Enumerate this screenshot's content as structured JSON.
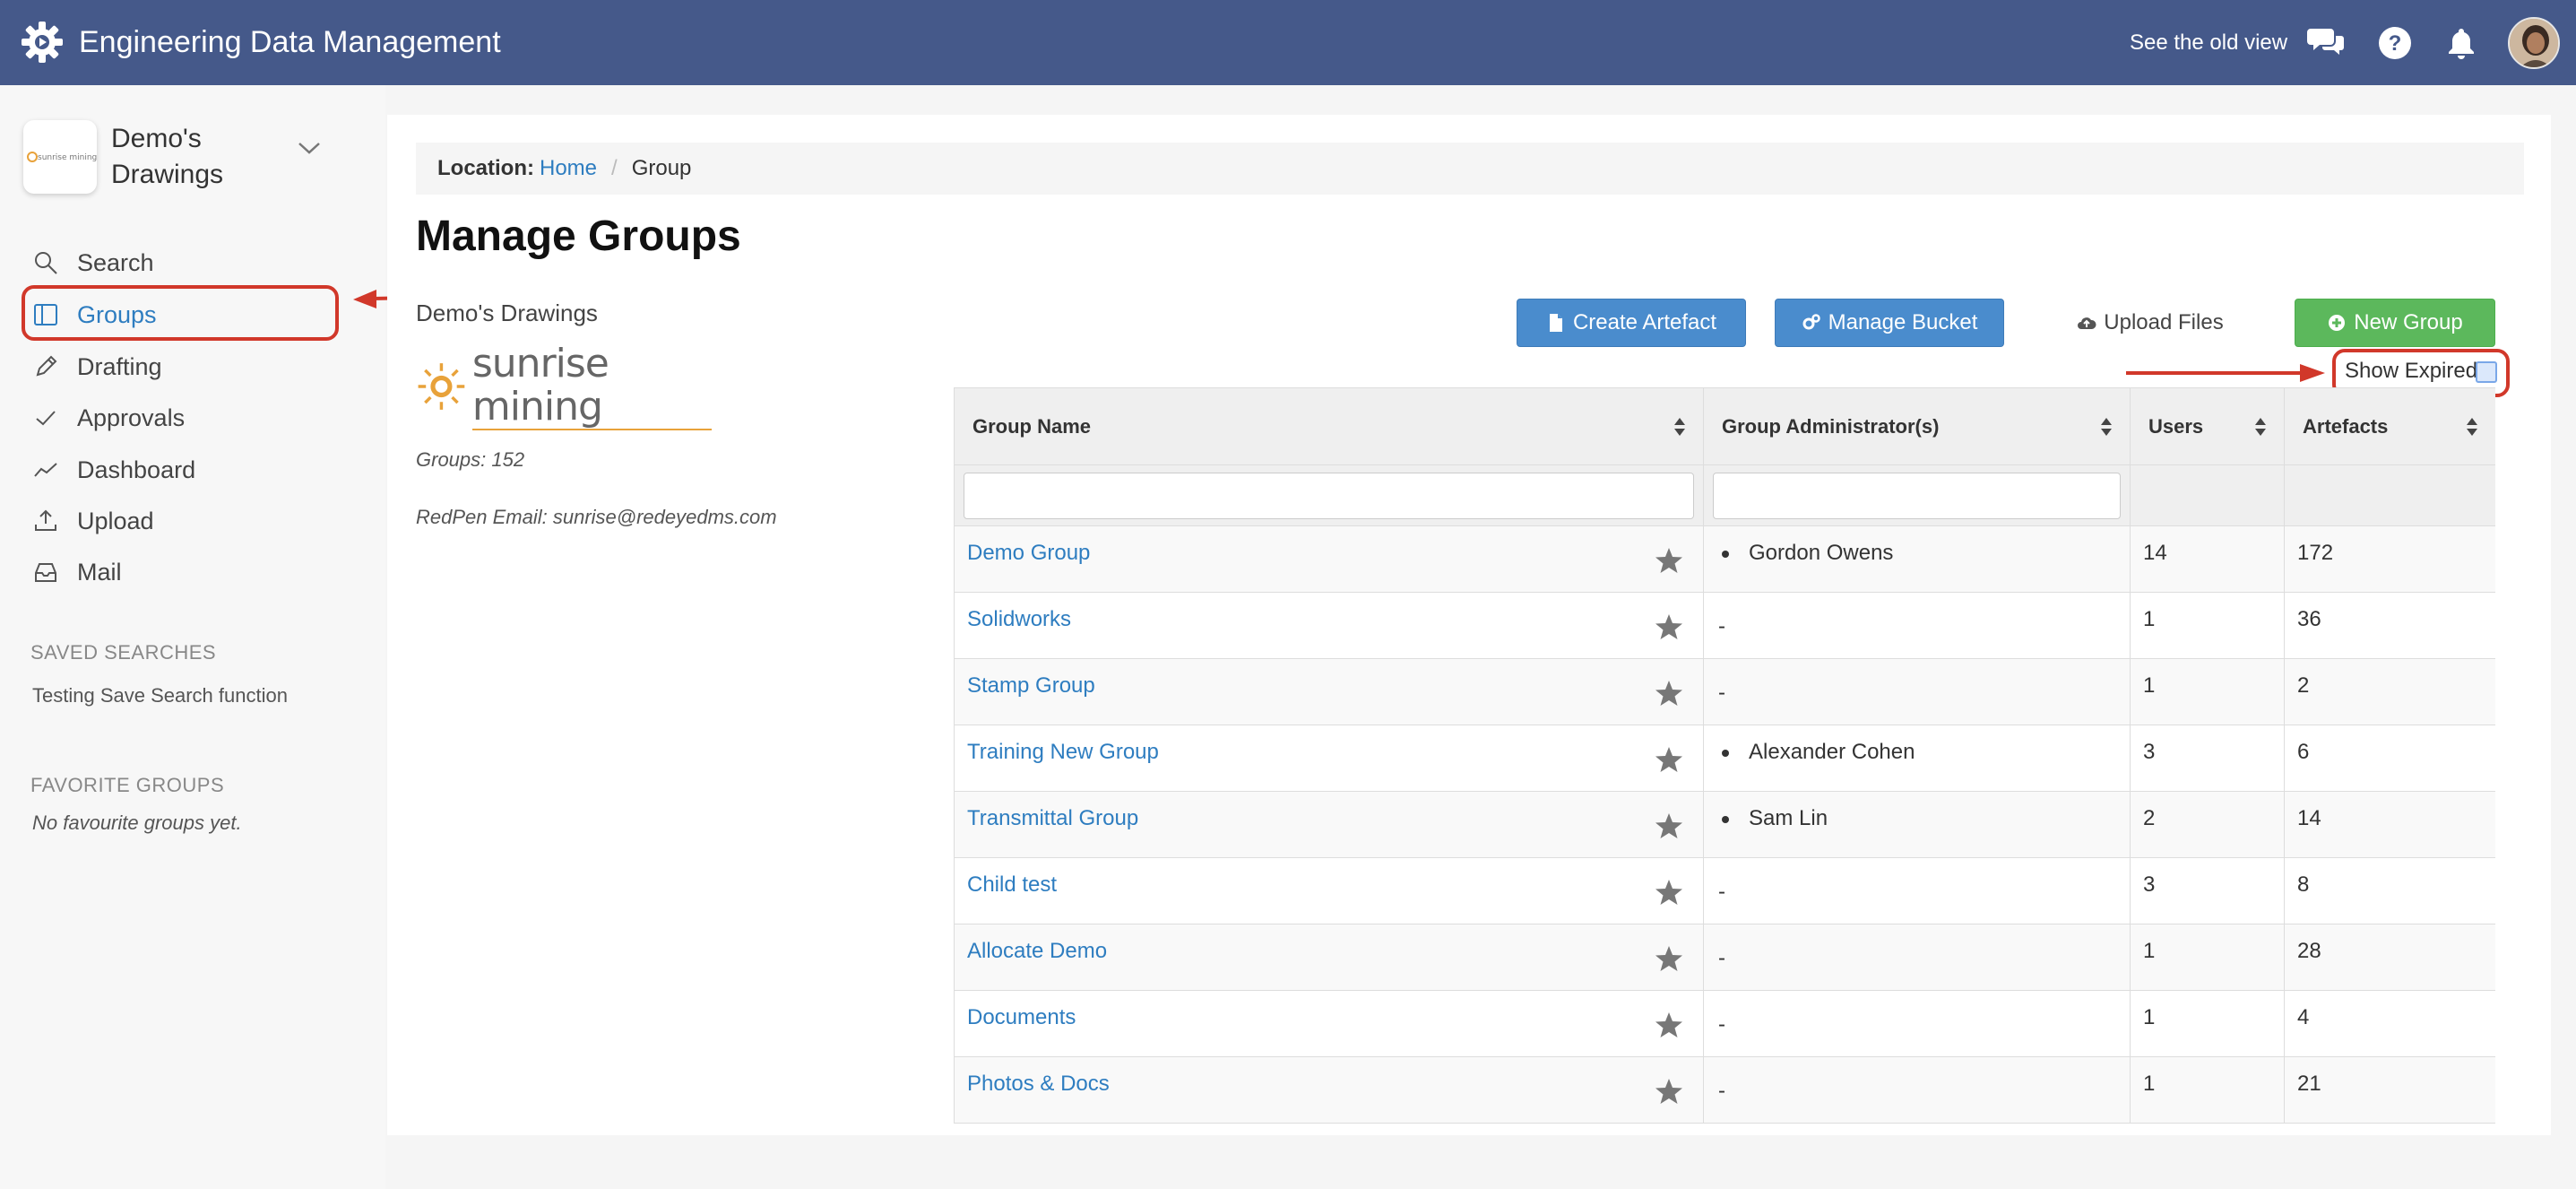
{
  "app": {
    "title": "Engineering Data Management"
  },
  "topbar": {
    "old_view": "See the old view"
  },
  "workspace": {
    "name": "Demo's Drawings",
    "logo_text": "sunrise mining"
  },
  "nav": [
    {
      "label": "Search",
      "icon": "search-icon"
    },
    {
      "label": "Groups",
      "icon": "groups-icon",
      "active": true
    },
    {
      "label": "Drafting",
      "icon": "pencil-icon"
    },
    {
      "label": "Approvals",
      "icon": "check-icon"
    },
    {
      "label": "Dashboard",
      "icon": "chart-line-icon"
    },
    {
      "label": "Upload",
      "icon": "upload-icon"
    },
    {
      "label": "Mail",
      "icon": "inbox-icon"
    }
  ],
  "saved_searches": {
    "heading": "SAVED SEARCHES",
    "items": [
      "Testing Save Search function"
    ]
  },
  "favorite_groups": {
    "heading": "FAVORITE GROUPS",
    "empty": "No favourite groups yet."
  },
  "breadcrumb": {
    "label": "Location:",
    "home": "Home",
    "current": "Group"
  },
  "page": {
    "title": "Manage Groups",
    "workspace_label": "Demo's Drawings",
    "logo_text": "sunrise mining",
    "groups_count": "Groups: 152",
    "email": "RedPen Email: sunrise@redeyedms.com"
  },
  "actions": {
    "create_artefact": "Create Artefact",
    "manage_bucket": "Manage Bucket",
    "upload_files": "Upload Files",
    "new_group": "New Group",
    "show_expired": "Show Expired"
  },
  "table": {
    "columns": [
      "Group Name",
      "Group Administrator(s)",
      "Users",
      "Artefacts"
    ],
    "rows": [
      {
        "name": "Demo Group",
        "admin": "Gordon Owens",
        "users": "14",
        "artefacts": "172"
      },
      {
        "name": "Solidworks",
        "admin": "-",
        "users": "1",
        "artefacts": "36"
      },
      {
        "name": "Stamp Group",
        "admin": "-",
        "users": "1",
        "artefacts": "2"
      },
      {
        "name": "Training New Group",
        "admin": "Alexander Cohen",
        "users": "3",
        "artefacts": "6"
      },
      {
        "name": "Transmittal Group",
        "admin": "Sam Lin",
        "users": "2",
        "artefacts": "14"
      },
      {
        "name": "Child test",
        "admin": "-",
        "users": "3",
        "artefacts": "8"
      },
      {
        "name": "Allocate Demo",
        "admin": "-",
        "users": "1",
        "artefacts": "28"
      },
      {
        "name": "Documents",
        "admin": "-",
        "users": "1",
        "artefacts": "4"
      },
      {
        "name": "Photos & Docs",
        "admin": "-",
        "users": "1",
        "artefacts": "21"
      }
    ]
  },
  "colors": {
    "topbar": "#45598a",
    "link": "#2e7dc0",
    "primary_button": "#4a8ccd",
    "success_button": "#5cb85c",
    "annotation": "#d1382a"
  }
}
